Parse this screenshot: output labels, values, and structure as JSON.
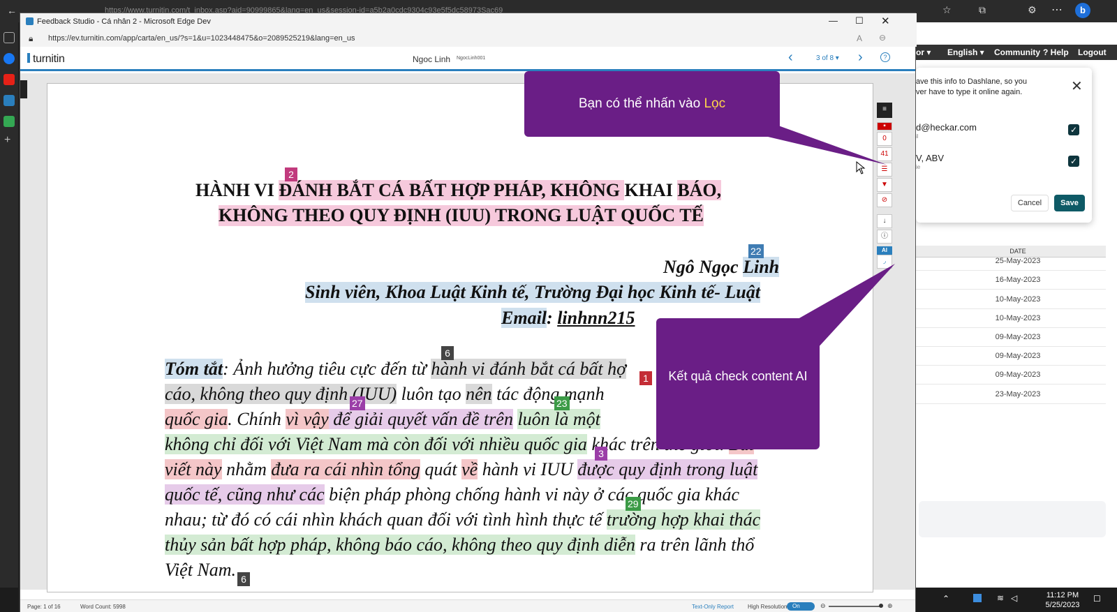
{
  "background_browser": {
    "url_fragment": "https://www.turnitin.com/t_inbox.asp?aid=90999865&lang=en_us&session-id=a5b2a0cdc9304c93e5f5dc58973Sac69",
    "nav_items": [
      "or ▾",
      "English ▾",
      "Community",
      "? Help",
      "Logout"
    ],
    "dashlane": {
      "message_line1": "ave this info to Dashlane, so you",
      "message_line2": "ver have to type it online again.",
      "item1_value": "d@heckar.com",
      "item1_sub": "il",
      "item2_value": "V, ABV",
      "item2_sub": "ie",
      "cancel_label": "Cancel",
      "save_label": "Save"
    },
    "date_table": {
      "header": "DATE",
      "rows": [
        "25-May-2023",
        "16-May-2023",
        "10-May-2023",
        "10-May-2023",
        "09-May-2023",
        "09-May-2023",
        "09-May-2023",
        "23-May-2023"
      ]
    },
    "clock": {
      "time": "11:12 PM",
      "date": "5/25/2023"
    }
  },
  "window": {
    "title": "Feedback Studio - Cá nhân 2 - Microsoft Edge Dev",
    "address": "https://ev.turnitin.com/app/carta/en_us/?s=1&u=1023448475&o=2089525219&lang=en_us"
  },
  "header": {
    "brand": "turnitin",
    "student_name": "Ngoc Linh",
    "student_id": "NgocLinh001",
    "pager": "3 of 8 ▾"
  },
  "document": {
    "title_line1": [
      "HÀNH VI ",
      "ĐÁNH BẮT CÁ BẤT HỢP PHÁP, KHÔNG ",
      "KHAI ",
      "BÁO,"
    ],
    "title_line2": "KHÔNG THEO QUY ĐỊNH (IUU) TRONG LUẬT QUỐC TẾ",
    "author_line1": [
      "Ngô Ngọc ",
      "Linh"
    ],
    "author_line2": "Sinh viên, Khoa Luật Kinh tế, Trường Đại học Kinh tế- Luật",
    "author_line3": [
      "Email",
      ": ",
      "linhnn215"
    ],
    "body": {
      "l1": [
        "Tóm tắt",
        ": Ảnh hưởng tiêu cực đến từ ",
        "hành vi đánh bắt cá bất hợ"
      ],
      "l2": [
        "cáo, không theo quy định ",
        "(IUU)",
        " luôn tạo ",
        "nên",
        " tác động mạnh "
      ],
      "l3": [
        "quốc gia",
        ". Chính ",
        "vì vậy",
        " để giải quyết vấn đề trên",
        " ",
        "luôn là một"
      ],
      "l4": [
        "không chỉ đối với ",
        "Việt Nam mà còn đối với nhiều quốc gia",
        " khác trên thế giới. ",
        "Bài"
      ],
      "l5": [
        "viết này",
        " nhằm ",
        "đưa ra cái nhìn tổng",
        " quát ",
        "về",
        " hành vi IUU ",
        "được quy định trong luật"
      ],
      "l6": [
        "quốc tế, cũng như các",
        " biện pháp phòng chống hành vi này ở các quốc gia khác"
      ],
      "l7": [
        "nhau; từ đó có cái nhìn khách quan đối với tình hình thực tế ",
        "trường hợp khai thác"
      ],
      "l8": [
        "thủy sản bất hợp pháp, không báo cáo, không theo quy định diễn",
        " ra trên lãnh thổ"
      ],
      "l9": "Việt Nam."
    },
    "markers": {
      "m2": "2",
      "m22": "22",
      "m6a": "6",
      "m27": "27",
      "m23": "23",
      "m1": "1",
      "m3": "3",
      "m29": "29",
      "m6b": "6"
    }
  },
  "tools": {
    "count_flags": "0",
    "count_score": "41",
    "ai_badge": "AI"
  },
  "footer": {
    "page": "Page: 1 of 16",
    "word_count": "Word Count: 5998",
    "text_only": "Text-Only Report",
    "high_res": "High Resolution",
    "toggle": "On"
  },
  "callouts": {
    "top_text": "Bạn có thể nhấn vào ",
    "top_highlight": "Lọc",
    "ai_text": "Kết quả check content AI"
  },
  "colors": {
    "accent": "#2a7fbd",
    "callout": "#6a1e86",
    "pink_highlight": "#f6c9dc",
    "blue_highlight": "#cfe0ee",
    "green_highlight": "#d3ebd3"
  }
}
